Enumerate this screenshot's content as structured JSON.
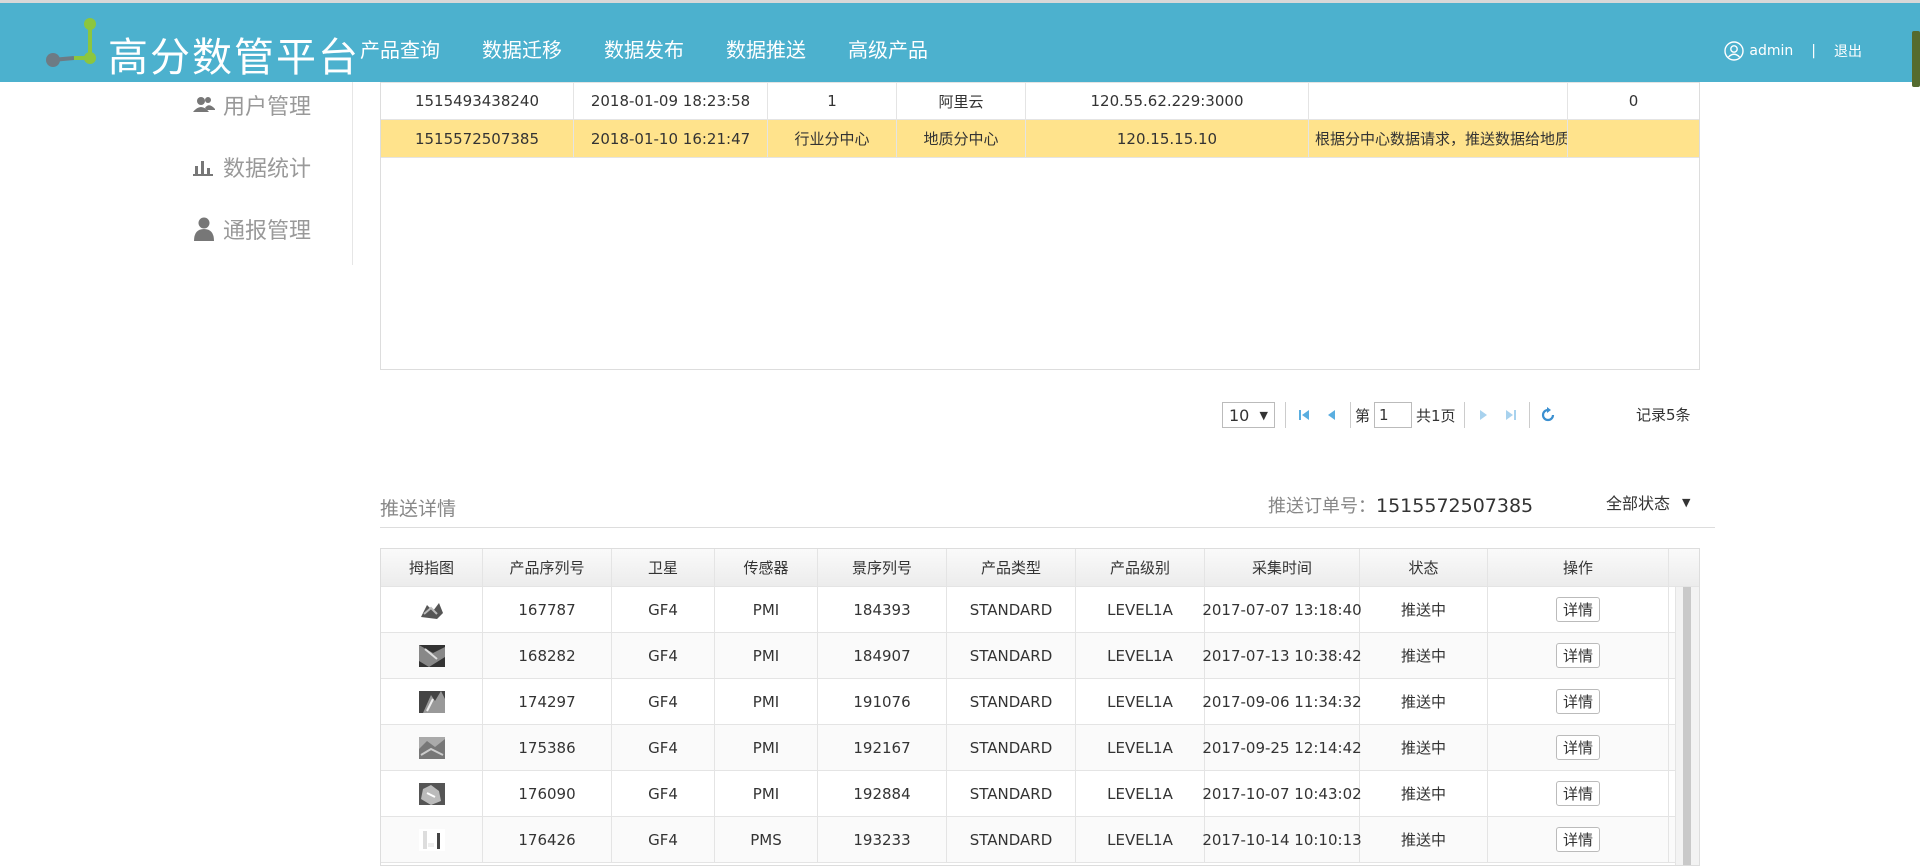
{
  "app": {
    "title": "高分数管平台"
  },
  "nav": [
    "产品查询",
    "数据迁移",
    "数据发布",
    "数据推送",
    "高级产品"
  ],
  "user": {
    "name": "admin",
    "separator": "|",
    "logout": "退出"
  },
  "sidebar": [
    {
      "label": "用户管理",
      "icon": "users-icon"
    },
    {
      "label": "数据统计",
      "icon": "bar-chart-icon"
    },
    {
      "label": "通报管理",
      "icon": "user-icon"
    }
  ],
  "top_table": {
    "rows": [
      [
        "1515493438240",
        "2018-01-09 18:23:58",
        "1",
        "阿里云",
        "120.55.62.229:3000",
        "",
        "0"
      ],
      [
        "1515572507385",
        "2018-01-10 16:21:47",
        "行业分中心",
        "地质分中心",
        "120.15.15.10",
        "根据分中心数据请求，推送数据给地质",
        ""
      ]
    ]
  },
  "pager": {
    "page_size": "10",
    "page_prefix": "第",
    "page_value": "1",
    "page_suffix": "共1页",
    "records": "记录5条"
  },
  "detail": {
    "title": "推送详情",
    "order_label": "推送订单号：",
    "order_no": "1515572507385",
    "status_filter": "全部状态",
    "headers": [
      "拇指图",
      "产品序列号",
      "卫星",
      "传感器",
      "景序列号",
      "产品类型",
      "产品级别",
      "采集时间",
      "状态",
      "操作"
    ],
    "button_label": "详情",
    "rows": [
      [
        "167787",
        "GF4",
        "PMI",
        "184393",
        "STANDARD",
        "LEVEL1A",
        "2017-07-07 13:18:40",
        "推送中"
      ],
      [
        "168282",
        "GF4",
        "PMI",
        "184907",
        "STANDARD",
        "LEVEL1A",
        "2017-07-13 10:38:42",
        "推送中"
      ],
      [
        "174297",
        "GF4",
        "PMI",
        "191076",
        "STANDARD",
        "LEVEL1A",
        "2017-09-06 11:34:32",
        "推送中"
      ],
      [
        "175386",
        "GF4",
        "PMI",
        "192167",
        "STANDARD",
        "LEVEL1A",
        "2017-09-25 12:14:42",
        "推送中"
      ],
      [
        "176090",
        "GF4",
        "PMI",
        "192884",
        "STANDARD",
        "LEVEL1A",
        "2017-10-07 10:43:02",
        "推送中"
      ],
      [
        "176426",
        "GF4",
        "PMS",
        "193233",
        "STANDARD",
        "LEVEL1A",
        "2017-10-14 10:10:13",
        "推送中"
      ]
    ]
  },
  "colors": {
    "header_bg": "#4cb1ce",
    "highlight_row": "#ffe38c",
    "logo_green": "#8cc63f",
    "logo_gray": "#6d7b84",
    "pager_blue": "#5aaee0"
  }
}
